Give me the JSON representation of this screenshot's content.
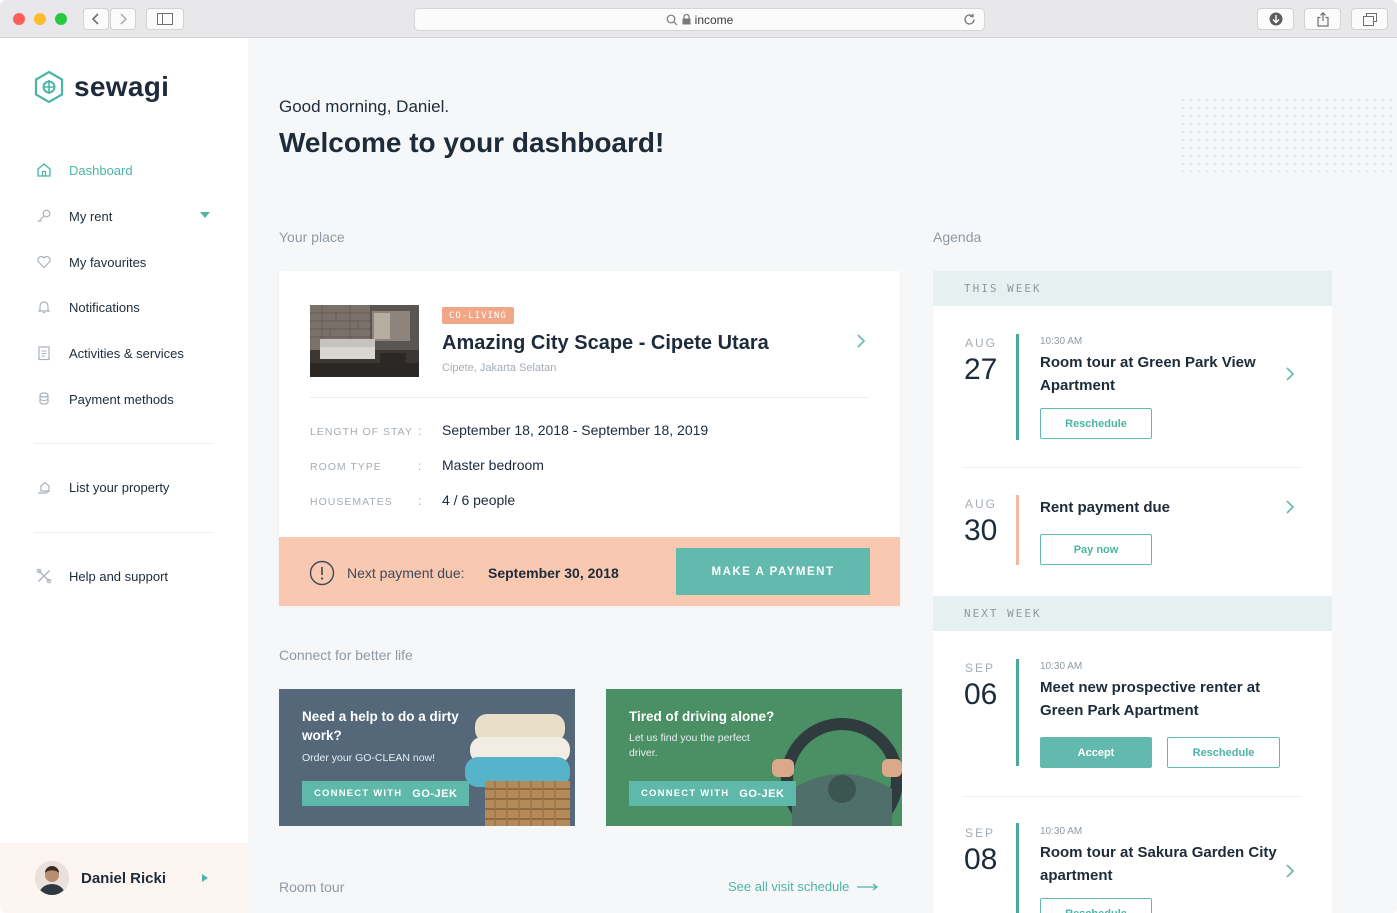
{
  "browser": {
    "address": "income"
  },
  "brand": {
    "name": "sewagi",
    "accent": "#4bb5a6",
    "peach": "#f8c9b0"
  },
  "sidebar": {
    "items": [
      {
        "label": "Dashboard",
        "icon": "home-icon",
        "active": true
      },
      {
        "label": "My rent",
        "icon": "key-icon"
      },
      {
        "label": "My favourites",
        "icon": "heart-icon"
      },
      {
        "label": "Notifications",
        "icon": "bell-icon"
      },
      {
        "label": "Activities & services",
        "icon": "clipboard-icon"
      },
      {
        "label": "Payment methods",
        "icon": "coins-icon"
      }
    ],
    "list_property": "List your property",
    "help": "Help and support",
    "user_name": "Daniel Ricki"
  },
  "header": {
    "greeting": "Good morning, Daniel.",
    "welcome": "Welcome to your dashboard!"
  },
  "place": {
    "section_label": "Your place",
    "badge": "CO-LIVING",
    "title": "Amazing City Scape - Cipete Utara",
    "location": "Cipete, Jakarta Selatan",
    "rows": [
      {
        "label": "LENGTH OF STAY",
        "value": "September 18, 2018 - September 18, 2019"
      },
      {
        "label": "ROOM TYPE",
        "value": "Master bedroom"
      },
      {
        "label": "HOUSEMATES",
        "value": "4 / 6 people"
      }
    ],
    "payment_label": "Next payment due:",
    "payment_date": "September 30, 2018",
    "payment_button": "MAKE A PAYMENT"
  },
  "connect": {
    "section_label": "Connect for better life",
    "cards": [
      {
        "title": "Need a help to do a dirty work?",
        "subtitle": "Order your GO-CLEAN now!",
        "button": "CONNECT WITH",
        "partner": "GO-JEK"
      },
      {
        "title": "Tired of driving alone?",
        "subtitle": "Let us find you the perfect driver.",
        "button": "CONNECT WITH",
        "partner": "GO-JEK"
      }
    ]
  },
  "room_tour": {
    "section_label": "Room tour",
    "see_all": "See all visit schedule"
  },
  "agenda": {
    "section_label": "Agenda",
    "this_week": "THIS WEEK",
    "next_week": "NEXT WEEK",
    "events": [
      {
        "month": "AUG",
        "day": "27",
        "time": "10:30 AM",
        "title": "Room tour at Green Park View Apartment",
        "buttons": [
          "Reschedule"
        ]
      },
      {
        "month": "AUG",
        "day": "30",
        "time": "",
        "title": "Rent payment due",
        "buttons": [
          "Pay now"
        ]
      },
      {
        "month": "SEP",
        "day": "06",
        "time": "10:30 AM",
        "title": "Meet new prospective renter at Green Park Apartment",
        "buttons": [
          "Accept",
          "Reschedule"
        ]
      },
      {
        "month": "SEP",
        "day": "08",
        "time": "10:30 AM",
        "title": "Room tour at Sakura Garden City apartment",
        "buttons": [
          "Reschedule"
        ]
      }
    ]
  }
}
